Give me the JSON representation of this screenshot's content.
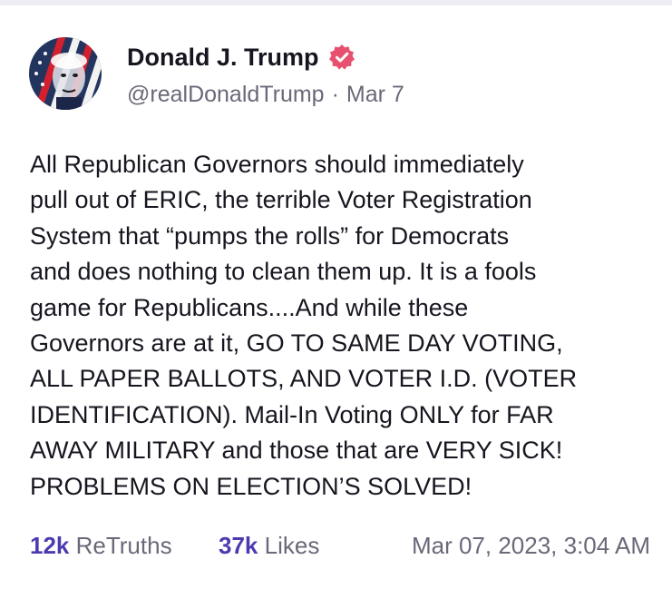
{
  "post": {
    "author": {
      "display_name": "Donald J. Trump",
      "handle": "@realDonaldTrump",
      "separator": "·",
      "date": "Mar 7",
      "verified_icon": "verified-badge-icon",
      "avatar": "user-avatar"
    },
    "lines": [
      "All Republican Governors should immediately",
      "pull out of ERIC, the terrible Voter Registration",
      "System that “pumps the rolls” for Democrats",
      "and does nothing to clean them up. It is a fools",
      "game for Republicans....And while these",
      "Governors are at it, GO TO SAME DAY VOTING,",
      "ALL PAPER BALLOTS, AND VOTER I.D. (VOTER",
      "IDENTIFICATION). Mail-In Voting ONLY for FAR",
      "AWAY MILITARY and those that are VERY SICK!",
      "PROBLEMS ON ELECTION’S SOLVED!"
    ],
    "stats": {
      "retruths_count": "12k",
      "retruths_label": "ReTruths",
      "likes_count": "37k",
      "likes_label": "Likes",
      "timestamp": "Mar 07, 2023, 3:04 AM"
    },
    "colors": {
      "accent": "#4c3bb0",
      "verified": "#e8506f",
      "text": "#17151f",
      "muted": "#6b6878"
    }
  }
}
